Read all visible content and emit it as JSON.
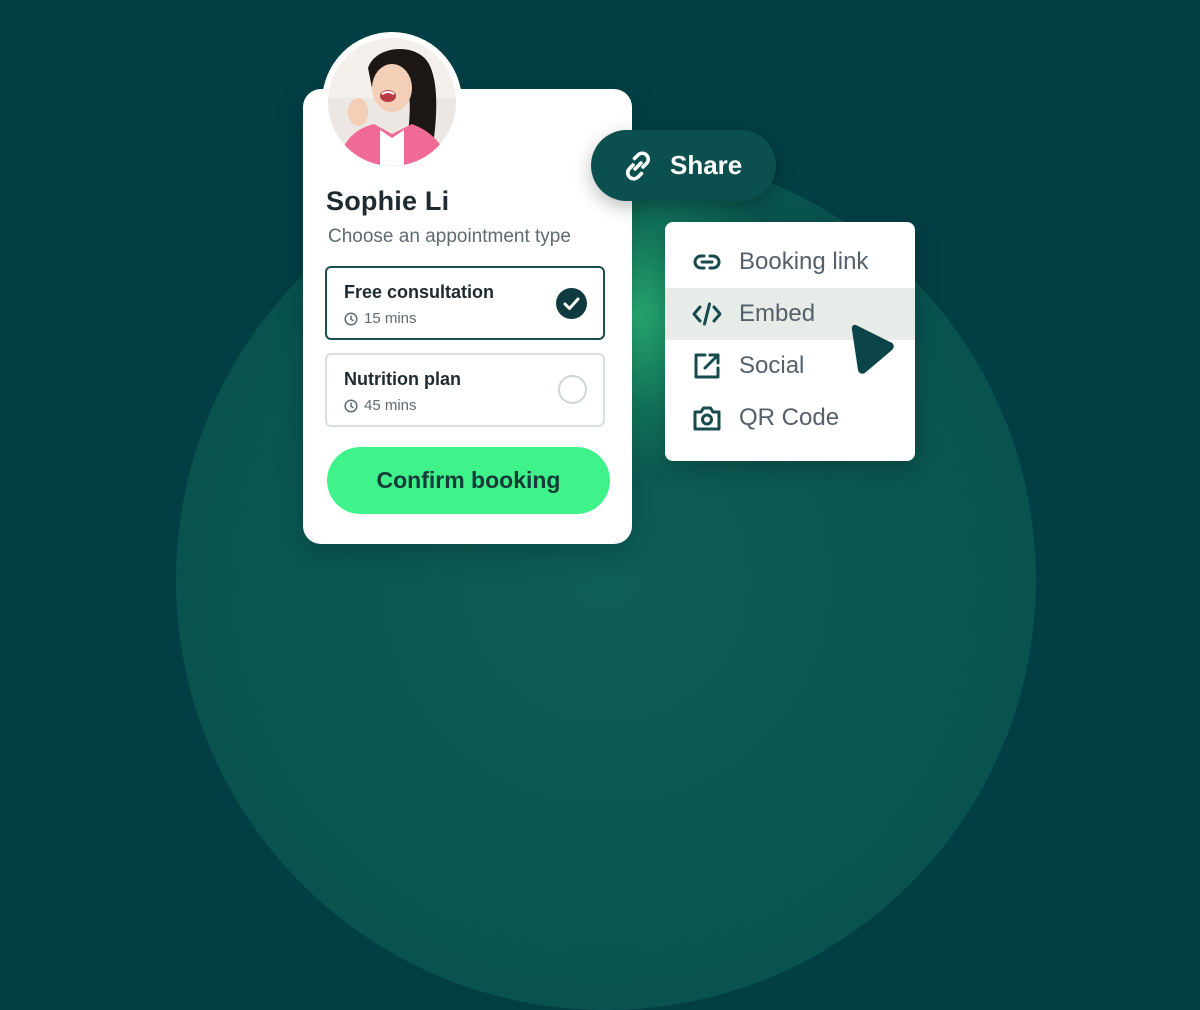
{
  "profile": {
    "name": "Sophie Li",
    "subtitle": "Choose an appointment type"
  },
  "appointments": [
    {
      "title": "Free consultation",
      "duration": "15 mins",
      "selected": true
    },
    {
      "title": "Nutrition plan",
      "duration": "45 mins",
      "selected": false
    }
  ],
  "confirm_label": "Confirm booking",
  "share": {
    "label": "Share",
    "menu": [
      {
        "label": "Booking link",
        "icon": "link-icon"
      },
      {
        "label": "Embed",
        "icon": "code-icon",
        "hovered": true
      },
      {
        "label": "Social",
        "icon": "external-link-icon"
      },
      {
        "label": "QR Code",
        "icon": "camera-icon"
      }
    ]
  },
  "colors": {
    "background": "#013f45",
    "accent": "#3ff38a",
    "dark_teal": "#0f3b40"
  }
}
